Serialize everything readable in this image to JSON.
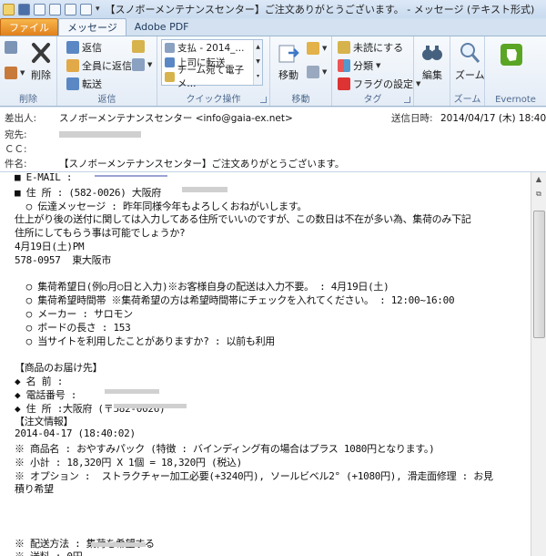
{
  "window": {
    "title": "【スノボーメンテナンスセンター】ご注文ありがとうございます。 - メッセージ (テキスト形式)"
  },
  "tabs": [
    {
      "label": "ファイル"
    },
    {
      "label": "メッセージ"
    },
    {
      "label": "Adobe PDF"
    }
  ],
  "ribbon": {
    "delete_group": {
      "label": "削除",
      "delete_label": "削除"
    },
    "reply_group": {
      "label": "返信",
      "reply": "返信",
      "reply_all": "全員に返信",
      "forward": "転送"
    },
    "quickstep_group": {
      "label": "クイック操作",
      "items": [
        "支払 - 2014_...",
        "上司に転送",
        "チーム宛て電子メ..."
      ]
    },
    "move_group": {
      "label": "移動",
      "move": "移動"
    },
    "tags_group": {
      "label": "タグ",
      "unread": "未読にする",
      "categorize": "分類",
      "followup": "フラグの設定"
    },
    "edit_group": {
      "label": "編集"
    },
    "zoom_group": {
      "label": "ズーム",
      "zoom": "ズーム"
    },
    "evernote_group": {
      "label": "Evernote"
    }
  },
  "header": {
    "from_label": "差出人:",
    "from_value": "スノボーメンテナンスセンター <info@gaia-ex.net>",
    "sent_label": "送信日時:",
    "sent_value": "2014/04/17 (木) 18:40",
    "to_label": "宛先:",
    "cc_label": "ＣＣ:",
    "subject_label": "件名:",
    "subject_value": "【スノボーメンテナンスセンター】ご注文ありがとうございます。"
  },
  "body": {
    "lines": [
      "■ E-MAIL :",
      "■ 住 所 : (582-0026) 大阪府",
      "  ○ 伝達メッセージ : 昨年同様今年もよろしくおねがいします。",
      "仕上がり後の送付に関しては入力してある住所でいいのですが、この数日は不在が多い為、集荷のみ下記",
      "住所にしてもらう事は可能でしょうか?",
      "4月19日(土)PM",
      "578-0957  東大阪市",
      "",
      "  ○ 集荷希望日(例○月○日と入力)※お客様自身の配送は入力不要。 : 4月19日(土)",
      "  ○ 集荷希望時間帯 ※集荷希望の方は希望時間帯にチェックを入れてください。 : 12:00~16:00",
      "  ○ メーカー : サロモン",
      "  ○ ボードの長さ : 153",
      "  ○ 当サイトを利用したことがありますか? : 以前も利用",
      "",
      "【商品のお届け先】",
      "◆ 名 前 :",
      "◆ 電話番号 :",
      "◆ 住 所 :大阪府 (〒582-0026)",
      "【注文情報】",
      "2014-04-17 (18:40:02)",
      "※ 商品名 : おやすみパック (特徴 : バインディング有の場合はプラス 1080円となります。)",
      "※ 小計 : 18,320円 X 1個 = 18,320円 (税込)",
      "※ オプション :  ストラクチャー加工必要(+3240円), ソールビベル2° (+1080円), 滑走面修理 : お見",
      "積り希望",
      "",
      "",
      "",
      "※ 配送方法 : 集荷を希望する",
      "※ 送料 : 0円"
    ]
  }
}
